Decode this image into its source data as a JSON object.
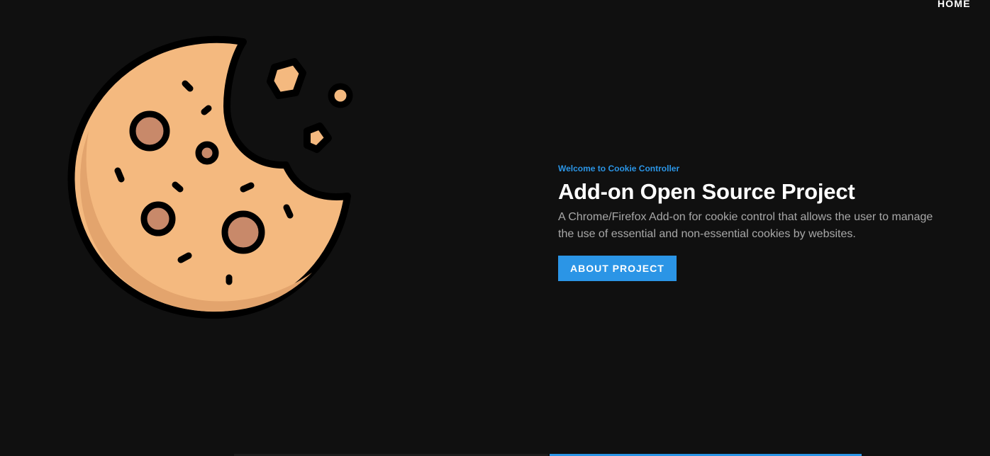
{
  "nav": {
    "home_label": "HOME"
  },
  "hero": {
    "eyebrow": "Welcome to Cookie Controller",
    "title": "Add-on Open Source Project",
    "description": "A Chrome/Firefox Add-on for cookie control that allows the user to manage the use of essential and non-essential cookies by websites.",
    "button_label": "ABOUT PROJECT",
    "illustration_icon": "cookie-icon"
  },
  "colors": {
    "background": "#101010",
    "accent": "#2b95e6",
    "cookie_body": "#f4b97f",
    "cookie_shade": "#e3a46d",
    "chip": "#c8896a"
  }
}
